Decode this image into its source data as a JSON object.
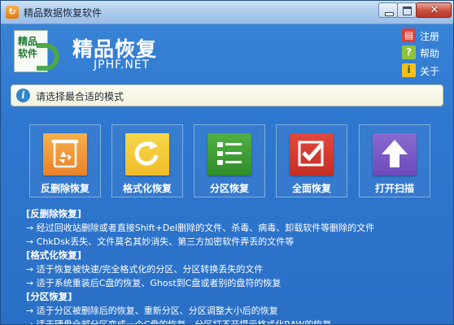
{
  "window": {
    "title": "精品数据恢复软件",
    "close_glyph": "✕"
  },
  "header": {
    "logo_text": "精品软件",
    "brand": "精品恢复",
    "site": "JPHF.NET",
    "links": [
      {
        "label": "注册",
        "icon": "register-icon"
      },
      {
        "label": "帮助",
        "icon": "help-icon"
      },
      {
        "label": "关于",
        "icon": "about-icon"
      }
    ]
  },
  "info": {
    "icon": "info-icon",
    "text": "请选择最合适的模式"
  },
  "modes": [
    {
      "label": "反删除恢复",
      "icon": "recycle-icon",
      "color": "#e9822a"
    },
    {
      "label": "格式化恢复",
      "icon": "format-icon",
      "color": "#f0bd2a"
    },
    {
      "label": "分区恢复",
      "icon": "partition-list-icon",
      "color": "#2f8d2b"
    },
    {
      "label": "全面恢复",
      "icon": "checkmark-icon",
      "color": "#c52e26"
    },
    {
      "label": "打开扫描",
      "icon": "upload-arrow-icon",
      "color": "#6c4bbb"
    }
  ],
  "descriptions": [
    {
      "heading": "[反删除恢复]",
      "lines": [
        "→ 经过回收站删除或者直接Shift+Del删除的文件、杀毒、病毒、卸载软件等删除的文件",
        "→ ChkDsk丢失、文件莫名其妙消失、第三方加密软件弄丢的文件等"
      ]
    },
    {
      "heading": "[格式化恢复]",
      "lines": [
        "→ 适于恢复被快速/完全格式化的分区、分区转换丢失的文件",
        "→ 适于系统重装后C盘的恢复、Ghost到C盘或者别的盘符的恢复"
      ]
    },
    {
      "heading": "[分区恢复]",
      "lines": [
        "→ 适于分区被删除后的恢复、重新分区、分区调整大小后的恢复",
        "→ 适于硬盘全部分区变成一个C盘的恢复、分区打不开提示格式化RAW的恢复"
      ]
    }
  ]
}
